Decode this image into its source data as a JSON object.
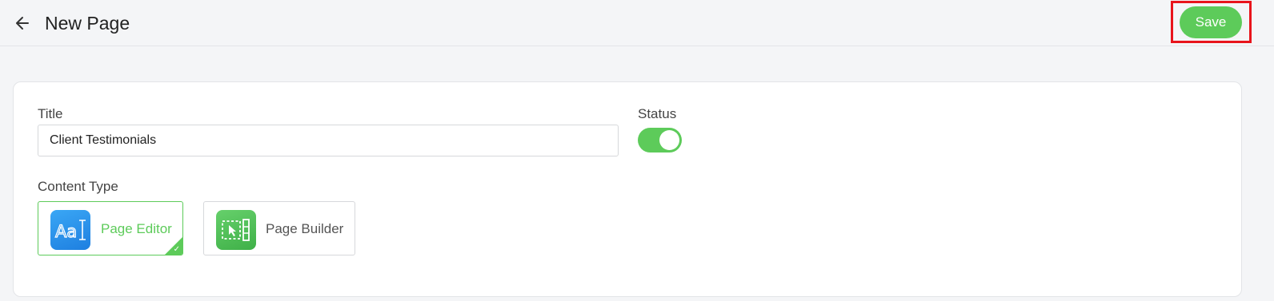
{
  "header": {
    "title": "New Page",
    "save_label": "Save",
    "back_icon": "arrow-left-icon"
  },
  "form": {
    "title_label": "Title",
    "title_value": "Client Testimonials",
    "status_label": "Status",
    "status_on": true,
    "content_type_label": "Content Type",
    "options": [
      {
        "label": "Page Editor",
        "icon": "text-editor-icon",
        "selected": true
      },
      {
        "label": "Page Builder",
        "icon": "layout-builder-icon",
        "selected": false
      }
    ]
  },
  "colors": {
    "accent": "#5dcb5a",
    "highlight": "#e8141c",
    "editor_icon_bg": "#1e7fe0",
    "builder_icon_bg": "#3fb048"
  }
}
